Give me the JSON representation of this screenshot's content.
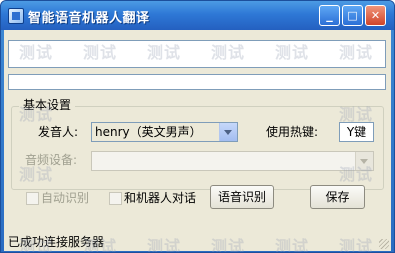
{
  "window": {
    "title": "智能语音机器人翻译",
    "controls": {
      "minimize": "_",
      "maximize": "□",
      "close": "✕"
    }
  },
  "output_text": "",
  "input_text": "",
  "settings": {
    "group_label": "基本设置",
    "speaker_label": "发音人:",
    "speaker_value": "henry（英文男声）",
    "hotkey_label": "使用热键:",
    "hotkey_value": "Y键",
    "audio_label": "音频设备:",
    "audio_value": ""
  },
  "options": {
    "auto_recognize_label": "自动识别",
    "auto_recognize_checked": false,
    "robot_chat_label": "和机器人对话",
    "robot_chat_checked": false
  },
  "buttons": {
    "speech_recognition": "语音识别",
    "save": "保存"
  },
  "status": {
    "text": "已成功连接服务器"
  },
  "watermark": {
    "text": "测试"
  },
  "icons": {
    "app": "app-icon",
    "resize": "resize-grip-icon"
  },
  "colors": {
    "title_bar": "#2e78d6",
    "client_bg": "#ece9d8",
    "field_border": "#7f9db9"
  }
}
